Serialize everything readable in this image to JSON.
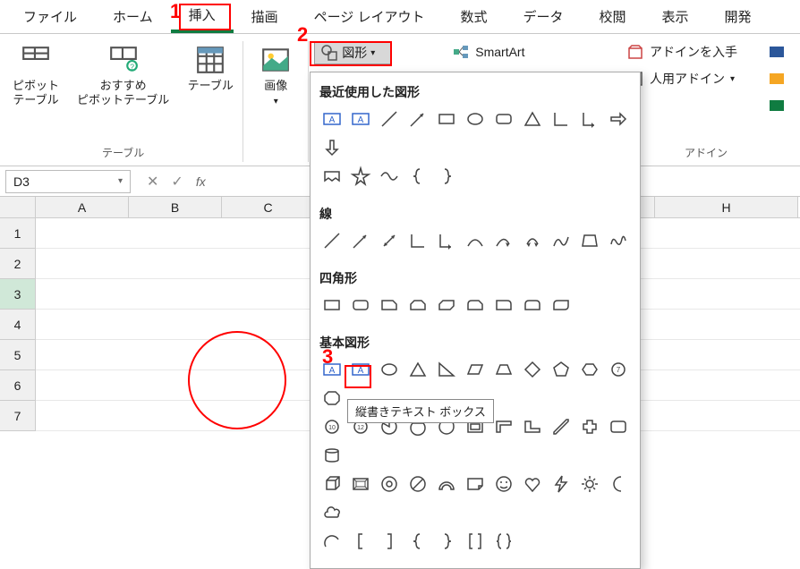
{
  "tabs": {
    "file": "ファイル",
    "home": "ホーム",
    "insert": "挿入",
    "draw": "描画",
    "layout": "ページ レイアウト",
    "formula": "数式",
    "data": "データ",
    "review": "校閲",
    "view": "表示",
    "dev": "開発"
  },
  "ribbon": {
    "pivot": "ピボット\nテーブル",
    "recpivot": "おすすめ\nピボットテーブル",
    "table": "テーブル",
    "tables_group": "テーブル",
    "image": "画像",
    "shapes": "図形",
    "smartart": "SmartArt",
    "getaddin": "アドインを入手",
    "myaddin": "人用アドイン",
    "addin_group": "アドイン"
  },
  "namebox": "D3",
  "cols": [
    "A",
    "B",
    "C",
    "",
    "H"
  ],
  "rows": [
    "1",
    "2",
    "3",
    "4",
    "5",
    "6",
    "7"
  ],
  "dd": {
    "recent": "最近使用した図形",
    "lines": "線",
    "rects": "四角形",
    "basic": "基本図形"
  },
  "tooltip": "縦書きテキスト ボックス",
  "anno": {
    "n1": "1",
    "n2": "2",
    "n3": "3"
  }
}
